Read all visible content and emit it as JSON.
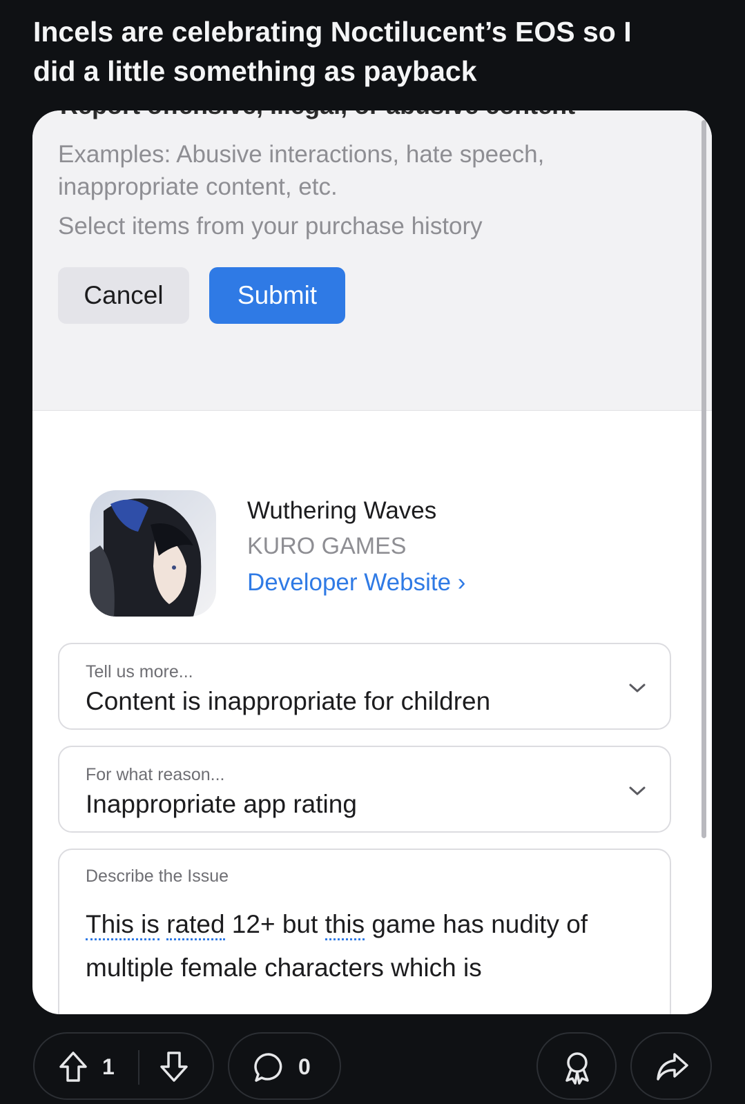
{
  "post": {
    "title_line1": "Incels are celebrating Noctilucent’s EOS so I",
    "title_line2": "did a little something as payback"
  },
  "report": {
    "heading_cut": "Report offensive, illegal, or abusive content",
    "examples": "Examples: Abusive interactions, hate speech, inappropriate content, etc.",
    "select_items": "Select items from your purchase history",
    "cancel_label": "Cancel",
    "submit_label": "Submit"
  },
  "app": {
    "name": "Wuthering Waves",
    "developer": "KURO GAMES",
    "developer_link": "Developer Website ›"
  },
  "fields": {
    "tell_more": {
      "label": "Tell us more...",
      "value": "Content is inappropriate for children"
    },
    "reason": {
      "label": "For what reason...",
      "value": "Inappropriate app rating"
    },
    "describe": {
      "label": "Describe the Issue",
      "text_w1": "This is",
      "text_w2": "rated",
      "text_mid": " 12+ but ",
      "text_w3": "this",
      "text_end": " game has nudity of",
      "text_line2": "multiple female characters which is"
    }
  },
  "actions": {
    "upvote_count": "1",
    "comment_count": "0"
  },
  "icons": [
    "chevron-down-icon",
    "upvote-icon",
    "downvote-icon",
    "comment-icon",
    "award-icon",
    "share-icon"
  ],
  "colors": {
    "background": "#0f1114",
    "accent": "#2f7ae5",
    "card": "#ffffff"
  }
}
